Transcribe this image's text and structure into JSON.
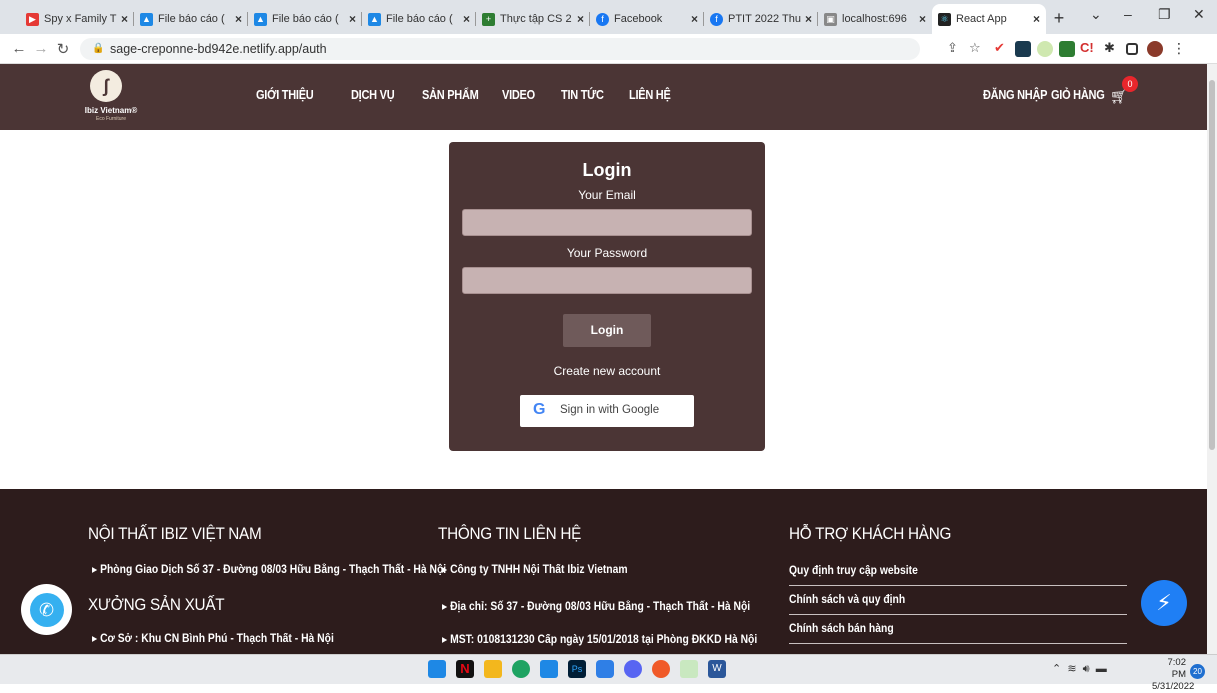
{
  "browser": {
    "tabs": [
      {
        "label": "Spy x Family T",
        "color": "#e53935",
        "glyph": "▶"
      },
      {
        "label": "File báo cáo (",
        "color": "#1e88e5",
        "glyph": "▲"
      },
      {
        "label": "File báo cáo (",
        "color": "#1e88e5",
        "glyph": "▲"
      },
      {
        "label": "File báo cáo (",
        "color": "#1e88e5",
        "glyph": "▲"
      },
      {
        "label": "Thực tập CS 2",
        "color": "#2e7d32",
        "glyph": "+"
      },
      {
        "label": "Facebook",
        "color": "#1877f2",
        "glyph": "f"
      },
      {
        "label": "PTIT 2022 Thu",
        "color": "#1877f2",
        "glyph": "f"
      },
      {
        "label": "localhost:696",
        "color": "#888888",
        "glyph": "▣"
      },
      {
        "label": "React App",
        "color": "#222222",
        "glyph": "⚛"
      }
    ],
    "url": "sage-creponne-bd942e.netlify.app/auth"
  },
  "nav": {
    "logo_name": "Ibiz Vietnam®",
    "logo_sub": "Eco Furniture",
    "items": [
      "GIỚI THIỆU",
      "DỊCH VỤ",
      "SẢN PHẨM",
      "VIDEO",
      "TIN TỨC",
      "LIÊN HỆ"
    ],
    "login": "ĐĂNG NHẬP",
    "cart": "GIỎ HÀNG",
    "cart_count": "0"
  },
  "login": {
    "title": "Login",
    "email_label": "Your Email",
    "email_value": "",
    "password_label": "Your Password",
    "password_value": "",
    "button": "Login",
    "create_account": "Create new account",
    "google": "Sign in with Google"
  },
  "footer": {
    "col1_title": "NỘI THẤT IBIZ VIỆT NAM",
    "col1_item": "Phòng Giao Dịch Số 37 - Đường 08/03 Hữu Bằng - Thạch Thất - Hà Nội",
    "col1_title2": "XƯỞNG SẢN XUẤT",
    "col1_item2": "Cơ Sở : Khu CN Bình Phú - Thạch Thất - Hà Nội",
    "col2_title": "THÔNG TIN LIÊN HỆ",
    "col2_items": [
      "Công ty TNHH Nội Thất Ibiz Vietnam",
      "Địa chỉ: Số 37 - Đường 08/03 Hữu Bằng - Thạch Thất - Hà Nội",
      "MST: 0108131230 Cấp ngày 15/01/2018 tại Phòng ĐKKD Hà Nội"
    ],
    "col3_title": "HỖ TRỢ KHÁCH HÀNG",
    "col3_items": [
      "Quy định truy cập website",
      "Chính sách và quy định",
      "Chính sách bán hàng"
    ]
  },
  "taskbar": {
    "time": "7:02 PM",
    "date": "5/31/2022",
    "notifications": "20"
  }
}
